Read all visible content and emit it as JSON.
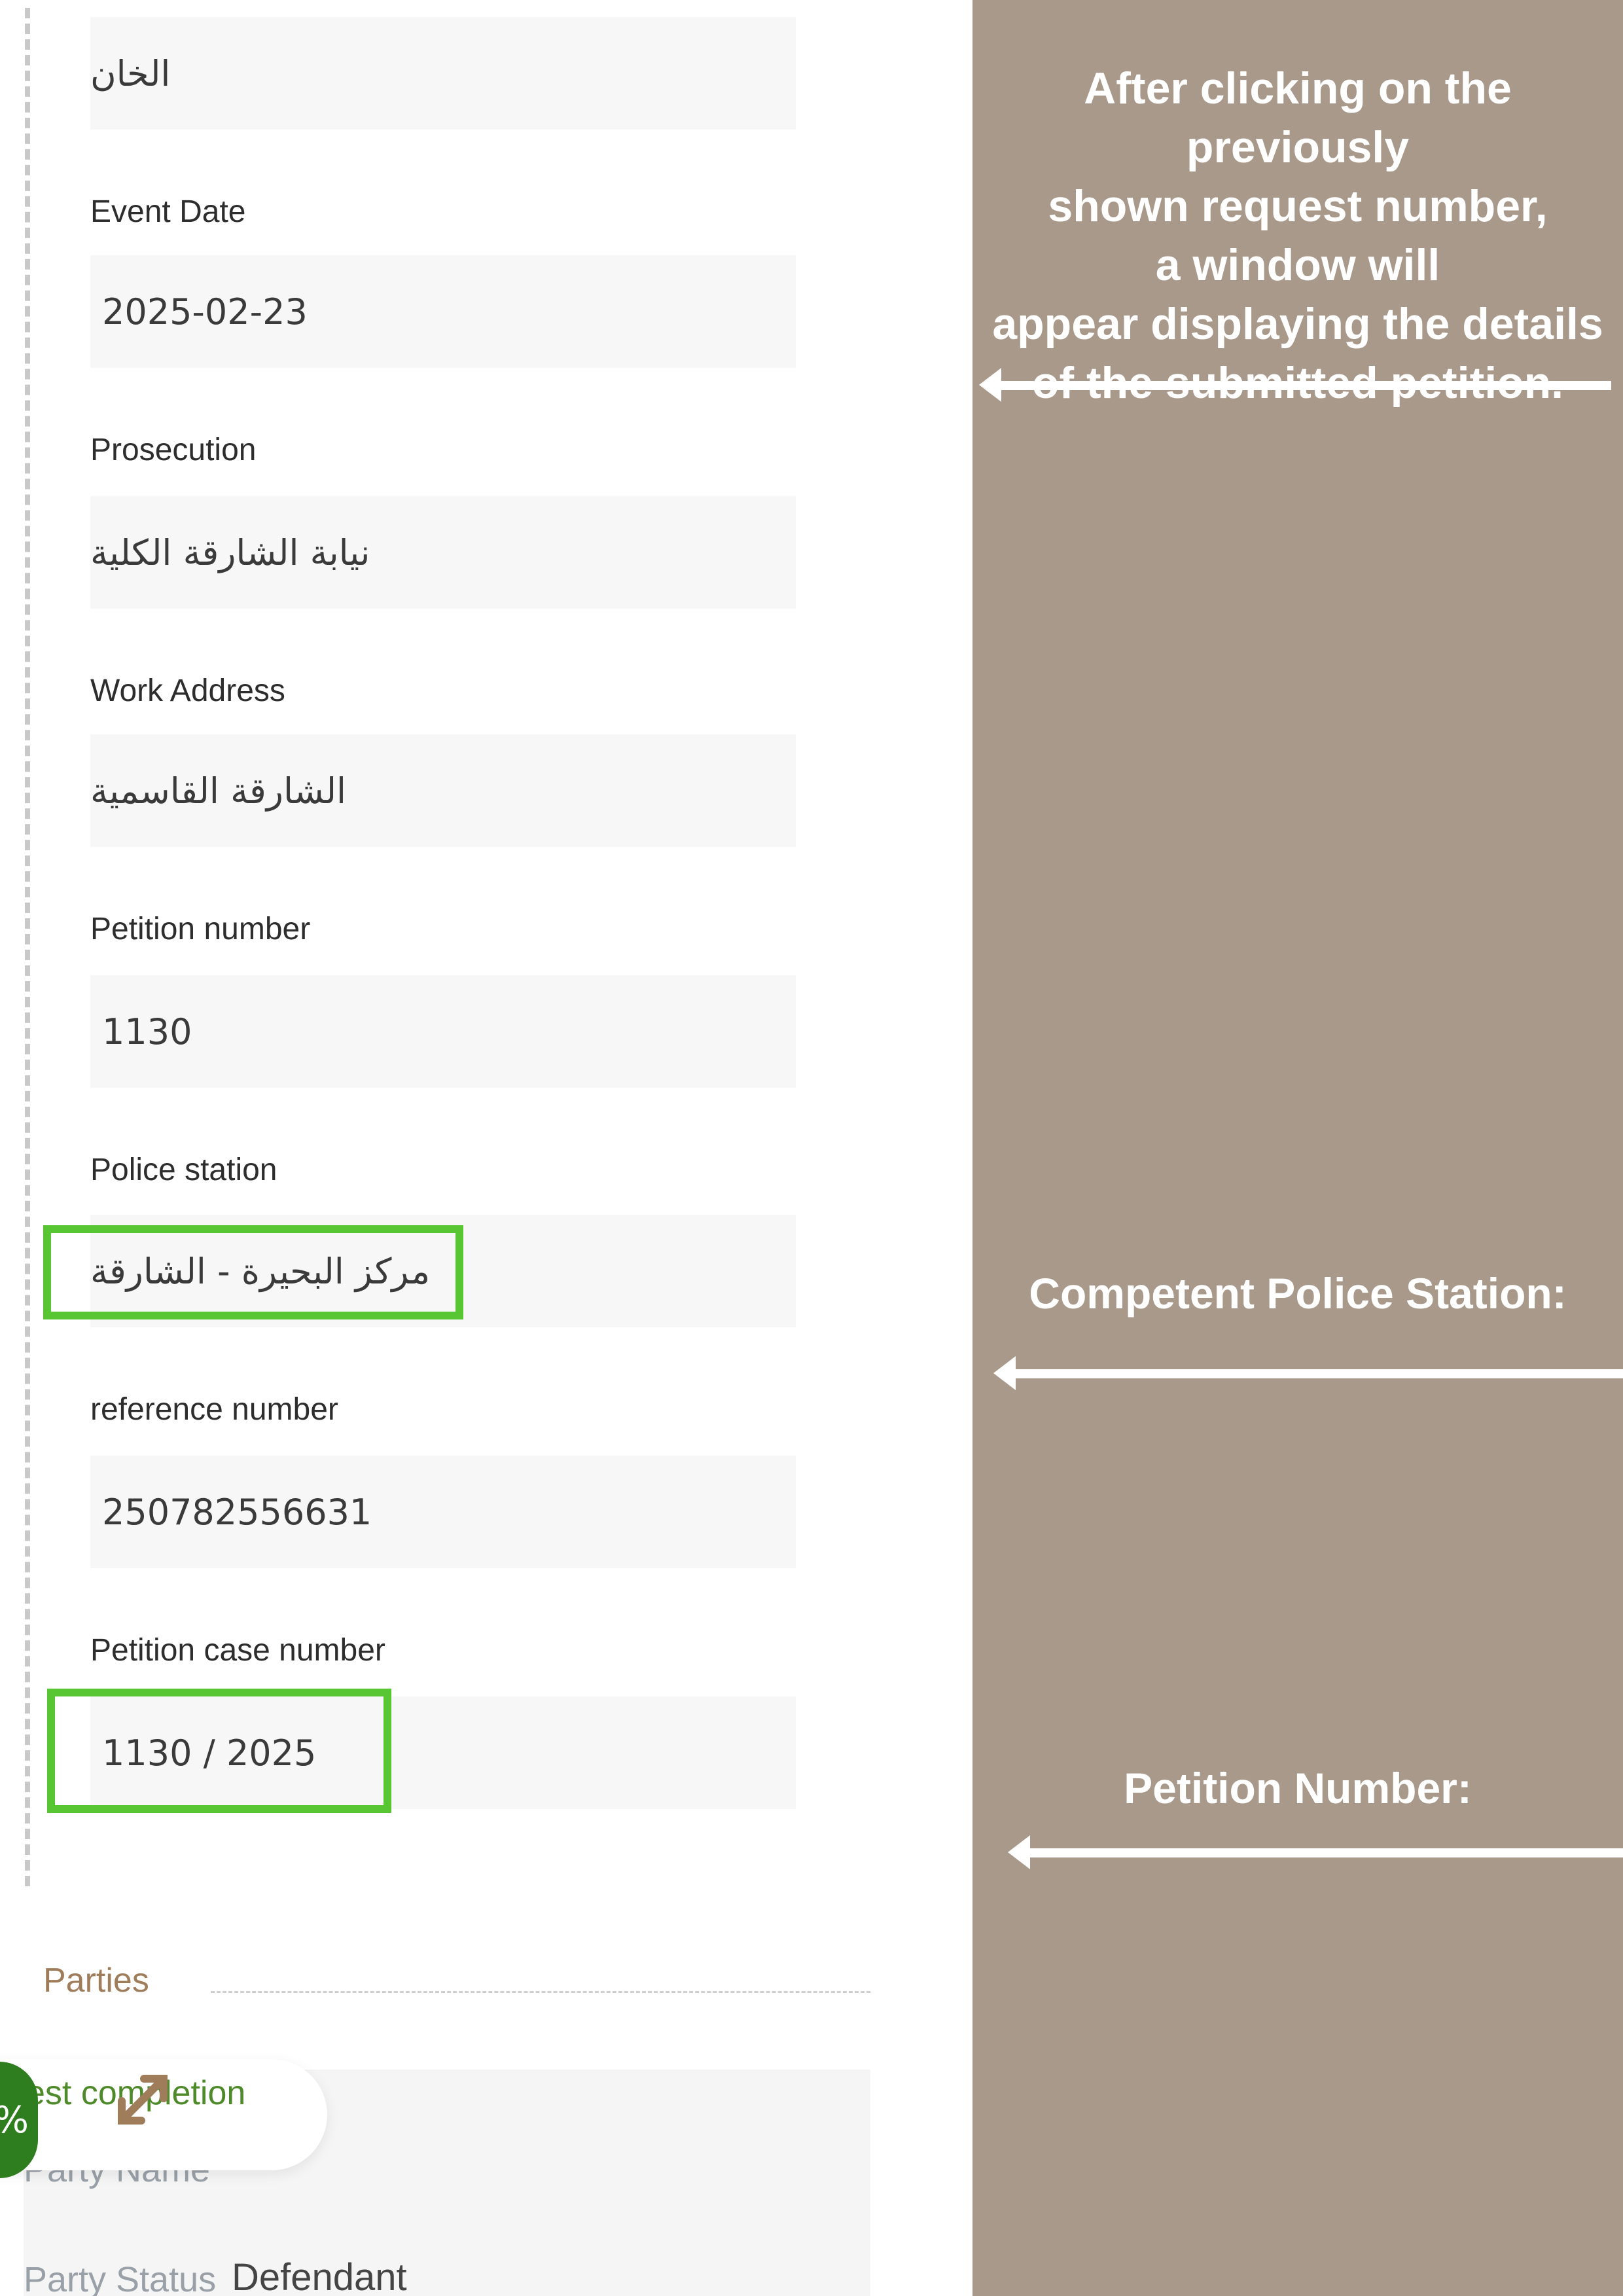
{
  "form": {
    "name_value": "الخان",
    "event_date": {
      "label": "Event Date",
      "value": "2025-02-23"
    },
    "prosecution": {
      "label": "Prosecution",
      "value": "نيابة الشارقة الكلية"
    },
    "work_address": {
      "label": "Work Address",
      "value": "الشارقة القاسمية"
    },
    "petition_number": {
      "label": "Petition number",
      "value": "1130"
    },
    "police_station": {
      "label": "Police station",
      "value": "مركز البحيرة - الشارقة"
    },
    "reference_number": {
      "label": "reference number",
      "value": "250782556631"
    },
    "petition_case_number": {
      "label": "Petition case number",
      "value": "1130 / 2025"
    }
  },
  "parties": {
    "title": "Parties",
    "party_name_label": "Party Name",
    "party_status_label": "Party Status",
    "party_status_value": "Defendant"
  },
  "widget": {
    "text": "est completion",
    "percent_symbol": "%",
    "icon": "expand-arrows-icon"
  },
  "annotations": {
    "intro_lines": [
      "After clicking on the previously",
      "shown request number,",
      "a window will",
      "appear displaying the details",
      "of the submitted petition."
    ],
    "police_station_note": "Competent Police Station:",
    "petition_number_note": "Petition Number:"
  },
  "colors": {
    "annotation_background": "#a8998a",
    "highlight_border": "#58c632",
    "section_title": "#a07d5a",
    "widget_green": "#2e7d1e"
  }
}
